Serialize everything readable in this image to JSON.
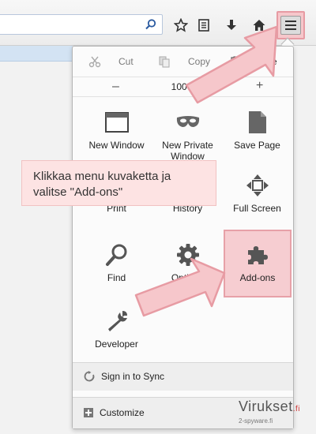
{
  "menu": {
    "cut": "Cut",
    "copy": "Copy",
    "paste": "Paste",
    "zoom_minus": "–",
    "zoom_level": "100%",
    "zoom_plus": "+",
    "items": [
      {
        "label": "New Window"
      },
      {
        "label": "New Private Window"
      },
      {
        "label": "Save Page"
      },
      {
        "label": "Print"
      },
      {
        "label": "History"
      },
      {
        "label": "Full Screen"
      },
      {
        "label": "Find"
      },
      {
        "label": "Options"
      },
      {
        "label": "Add-ons"
      },
      {
        "label": "Developer"
      }
    ],
    "sign_in": "Sign in to Sync",
    "customize": "Customize"
  },
  "callout": {
    "text": "Klikkaa menu kuvaketta ja valitse \"Add-ons\""
  },
  "watermark": {
    "brand": "Virukset",
    "brand_suffix": ".fi",
    "sub": "2-spyware.fi"
  },
  "colors": {
    "highlight": "#f6cdd1",
    "highlight_border": "#e7a1a8",
    "callout_bg": "#fde3e3"
  }
}
